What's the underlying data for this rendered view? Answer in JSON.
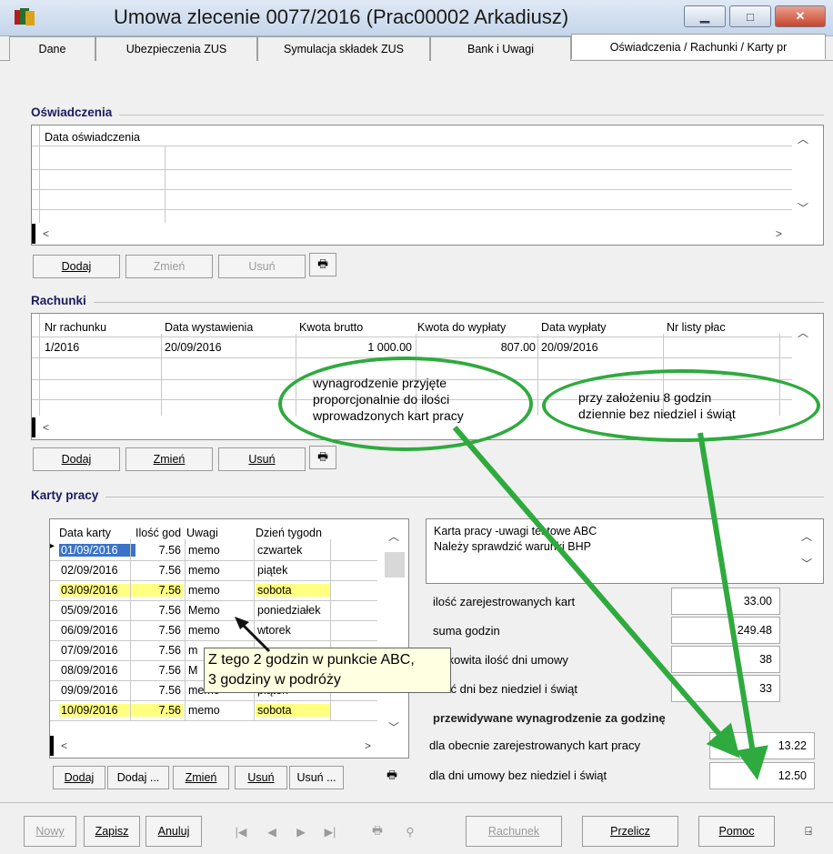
{
  "window": {
    "title": "Umowa zlecenie 0077/2016 (Prac00002 Arkadiusz)"
  },
  "tabs": [
    "Dane",
    "Ubezpieczenia ZUS",
    "Symulacja składek ZUS",
    "Bank i Uwagi",
    "Oświadczenia / Rachunki / Karty pr"
  ],
  "oswiadczenia": {
    "section_label": "Oświadczenia",
    "header": "Data oświadczenia",
    "buttons": {
      "add": "Dodaj",
      "edit": "Zmień",
      "delete": "Usuń"
    }
  },
  "rachunki": {
    "section_label": "Rachunki",
    "headers": [
      "Nr rachunku",
      "Data wystawienia",
      "Kwota brutto",
      "Kwota do wypłaty",
      "Data wypłaty",
      "Nr listy płac"
    ],
    "rows": [
      [
        "1/2016",
        "20/09/2016",
        "1 000.00",
        "807.00",
        "20/09/2016",
        ""
      ]
    ],
    "buttons": {
      "add": "Dodaj",
      "edit": "Zmień",
      "delete": "Usuń"
    }
  },
  "karty": {
    "section_label": "Karty pracy",
    "headers": [
      "Data karty",
      "Ilość god",
      "Uwagi",
      "Dzień tygodn"
    ],
    "rows": [
      [
        "01/09/2016",
        "7.56",
        "memo",
        "czwartek"
      ],
      [
        "02/09/2016",
        "7.56",
        "memo",
        "piątek"
      ],
      [
        "03/09/2016",
        "7.56",
        "memo",
        "sobota"
      ],
      [
        "05/09/2016",
        "7.56",
        "Memo",
        "poniedziałek"
      ],
      [
        "06/09/2016",
        "7.56",
        "memo",
        "wtorek"
      ],
      [
        "07/09/2016",
        "7.56",
        "m",
        ""
      ],
      [
        "08/09/2016",
        "7.56",
        "M",
        ""
      ],
      [
        "09/09/2016",
        "7.56",
        "memo",
        "piątek"
      ],
      [
        "10/09/2016",
        "7.56",
        "memo",
        "sobota"
      ]
    ],
    "buttons": {
      "add": "Dodaj",
      "add2": "Dodaj ...",
      "edit": "Zmień",
      "delete": "Usuń",
      "delete2": "Usuń ..."
    },
    "notes": "Karta pracy -uwagi testowe ABC\nNależy sprawdzić warunki BHP",
    "notes_line1": "Karta pracy -uwagi testowe ABC",
    "notes_line2": "Należy sprawdzić warunki BHP",
    "stats": {
      "count_label": "ilość zarejestrowanych kart",
      "count_value": "33.00",
      "hours_label": "suma godzin",
      "hours_value": "249.48",
      "days_label": "całkowita ilość dni umowy",
      "days_value": "38",
      "workdays_label": "ilość dni bez niedziel i świąt",
      "workdays_value": "33"
    },
    "pay_title": "przewidywane wynagrodzenie za godzinę",
    "pay_cards_label": "dla obecnie zarejestrowanych kart pracy",
    "pay_cards_value": "13.22",
    "pay_days_label": "dla dni umowy bez niedziel i świąt",
    "pay_days_value": "12.50"
  },
  "tooltip": {
    "line1": "Z tego 2 godzin w punkcie ABC,",
    "line2": "3 godziny w podróży"
  },
  "callouts": {
    "left": {
      "line1": "wynagrodzenie przyjęte",
      "line2": "proporcjonalnie do ilości",
      "line3": "wprowadzonych kart pracy"
    },
    "right": {
      "line1": "przy założeniu 8 godzin",
      "line2": "dziennie bez niedziel i świąt"
    }
  },
  "bottom": {
    "new": "Nowy",
    "save": "Zapisz",
    "cancel": "Anuluj",
    "invoice": "Rachunek",
    "recalc": "Przelicz",
    "help": "Pomoc"
  },
  "colors": {
    "highlight_yellow": "#ffff80",
    "selected": "#3a74c9",
    "callout_green": "#2faa3e"
  }
}
